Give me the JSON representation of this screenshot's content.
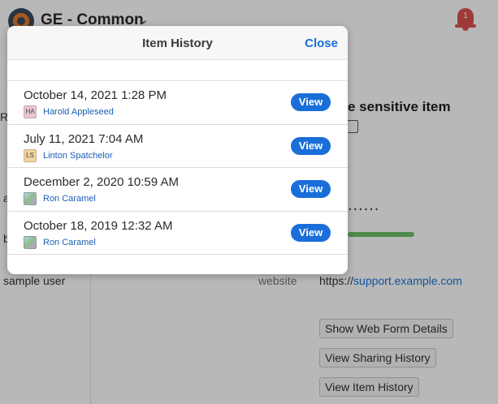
{
  "app": {
    "vault_name": "GE - Common",
    "notification_count": "1"
  },
  "sidebar": {
    "fragments": [
      "R",
      "a",
      "b"
    ],
    "sample_user": "sample user"
  },
  "detail": {
    "item_title": "e sensitive item",
    "password_dots": "......",
    "field_label": "website",
    "field_prefix": "https://",
    "field_link": "support.example.com",
    "buttons": [
      "Show Web Form Details",
      "View Sharing History",
      "View Item History"
    ]
  },
  "modal": {
    "title": "Item History",
    "close_label": "Close",
    "view_label": "View",
    "entries": [
      {
        "date": "October 14, 2021 1:28 PM",
        "user": "Harold Appleseed",
        "avatar_initials": "HA",
        "avatar_color": "#e9c6d3"
      },
      {
        "date": "July 11, 2021 7:04 AM",
        "user": "Linton Spatchelor",
        "avatar_initials": "LS",
        "avatar_color": "#f1d3a0"
      },
      {
        "date": "December 2, 2020 10:59 AM",
        "user": "Ron Caramel",
        "avatar_initials": "",
        "avatar_color": "#9cc7e0"
      },
      {
        "date": "October 18, 2019 12:32 AM",
        "user": "Ron Caramel",
        "avatar_initials": "",
        "avatar_color": "#9cc7e0"
      }
    ]
  },
  "colors": {
    "accent": "#1a6ed8",
    "link": "#1a5fb4",
    "strength": "#6cbf6a",
    "alert": "#d9534f"
  }
}
